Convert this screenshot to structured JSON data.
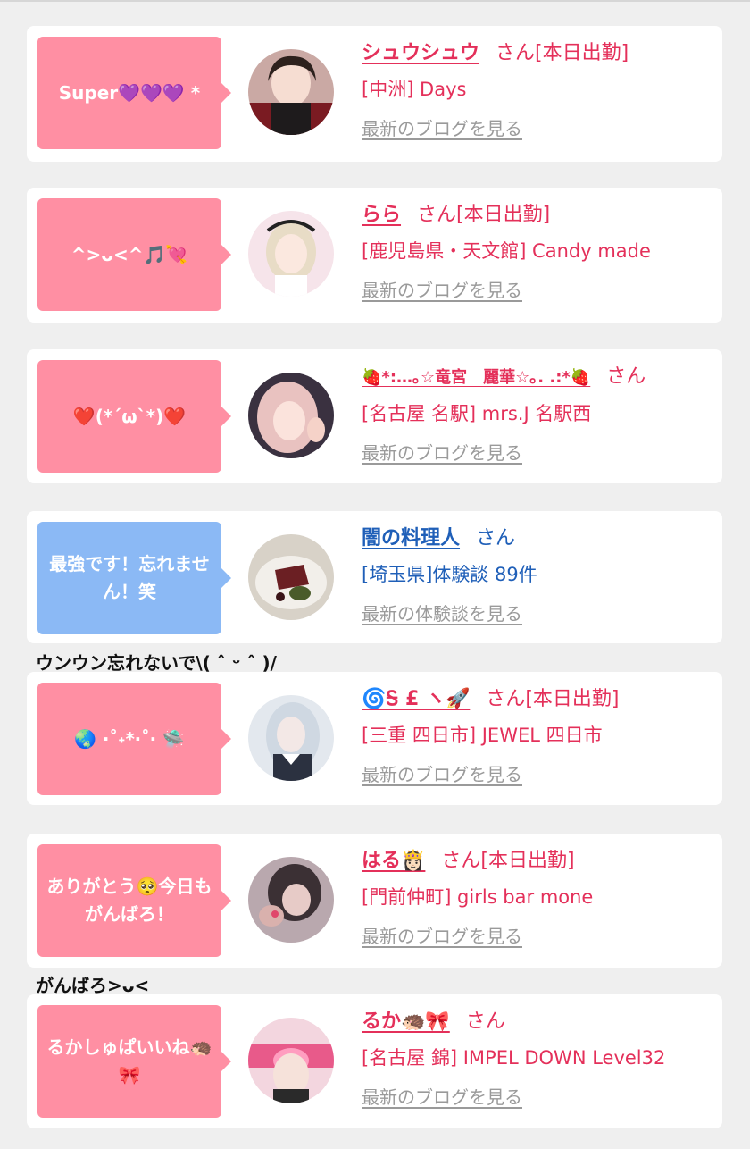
{
  "posts": [
    {
      "bubble": "Super💜💜💜 *",
      "name": "シュウシュウ",
      "san": "さん[本日出勤]",
      "shop": "[中洲] Days",
      "link": "最新のブログを見る"
    },
    {
      "bubble": "^>ᴗ<^🎵💘",
      "name": "らら",
      "san": "さん[本日出勤]",
      "shop": "[鹿児島県・天文館] Candy made",
      "link": "最新のブログを見る"
    },
    {
      "bubble": "❤️(*´ω`*)❤️",
      "name": "🍓*:…｡☆竜宮　麗華☆｡. .:*🍓",
      "san": "さん",
      "shop": "[名古屋 名駅] mrs.J 名駅西",
      "link": "最新のブログを見る"
    },
    {
      "bubble": "最強です！忘れません！笑",
      "name": "闇の料理人",
      "san": "さん",
      "shop": "[埼玉県]体験談 89件",
      "link": "最新の体験談を見る"
    },
    {
      "bubble": "🌏 ‧˚˖*‧˚‧ 🛸",
      "name": "🌀Ꭶ £ ヽ🚀",
      "san": "さん[本日出勤]",
      "shop": "[三重 四日市] JEWEL 四日市",
      "link": "最新のブログを見る"
    },
    {
      "bubble": "ありがとう🥺今日もがんばろ！",
      "name": "はる👸🏻",
      "san": "さん[本日出勤]",
      "shop": "[門前仲町] girls bar mone",
      "link": "最新のブログを見る"
    },
    {
      "bubble": "るかしゅぱいいね🦔🎀",
      "name": "るか🦔🎀",
      "san": "さん",
      "shop": "[名古屋 錦] IMPEL DOWN Level32",
      "link": "最新のブログを見る"
    }
  ],
  "replies": {
    "after_post_4": "ウンウン忘れないで\\( ˆ ᵕ ˆ )/",
    "after_post_6": "がんばろ>ᴗ<"
  },
  "colors": {
    "pink_bubble": "#ff8fa3",
    "blue_bubble": "#8bb9f5",
    "pink_text": "#e4305a",
    "blue_text": "#1f5fb8",
    "link_gray": "#9a9a9a"
  }
}
